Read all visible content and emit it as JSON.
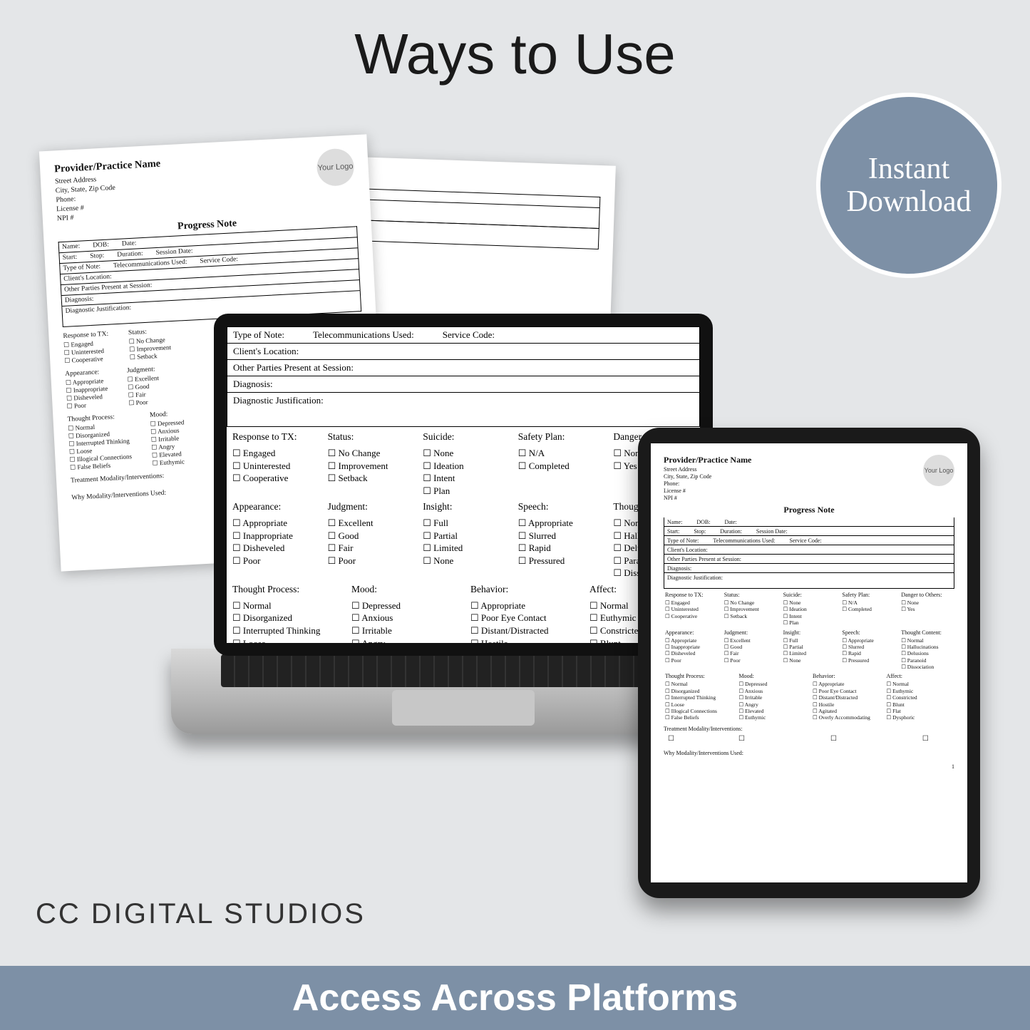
{
  "heading": "Ways to Use",
  "badge": {
    "line1": "Instant",
    "line2": "Download"
  },
  "brand": "CC DIGITAL STUDIOS",
  "footer": "Access Across Platforms",
  "provider": {
    "name": "Provider/Practice Name",
    "addr": [
      "Street Address",
      "City, State, Zip Code",
      "Phone:",
      "License #",
      "NPI #"
    ],
    "logo": "Your Logo"
  },
  "form": {
    "title": "Progress Note",
    "rows": {
      "name": "Name:",
      "dob": "DOB:",
      "date": "Date:",
      "start": "Start:",
      "stop": "Stop:",
      "duration": "Duration:",
      "session_date": "Session Date:",
      "type_of_note": "Type of Note:",
      "telecom": "Telecommunications Used:",
      "service_code": "Service Code:",
      "client_location": "Client's Location:",
      "other_parties": "Other Parties Present at Session:",
      "diagnosis": "Diagnosis:",
      "diag_just": "Diagnostic Justification:",
      "treatment_modality": "Treatment Modality/Interventions:",
      "why_modality": "Why Modality/Interventions Used:"
    },
    "sections": {
      "response_to_tx": {
        "title": "Response to TX:",
        "items": [
          "Engaged",
          "Uninterested",
          "Cooperative"
        ]
      },
      "status": {
        "title": "Status:",
        "items": [
          "No Change",
          "Improvement",
          "Setback"
        ]
      },
      "suicide": {
        "title": "Suicide:",
        "items": [
          "None",
          "Ideation",
          "Intent",
          "Plan"
        ]
      },
      "safety_plan": {
        "title": "Safety Plan:",
        "items": [
          "N/A",
          "Completed"
        ]
      },
      "danger": {
        "title": "Danger to Others:",
        "items": [
          "None",
          "Yes"
        ]
      },
      "appearance": {
        "title": "Appearance:",
        "items": [
          "Appropriate",
          "Inappropriate",
          "Disheveled",
          "Poor"
        ]
      },
      "judgment": {
        "title": "Judgment:",
        "items": [
          "Excellent",
          "Good",
          "Fair",
          "Poor"
        ]
      },
      "insight": {
        "title": "Insight:",
        "items": [
          "Full",
          "Partial",
          "Limited",
          "None"
        ]
      },
      "speech": {
        "title": "Speech:",
        "items": [
          "Appropriate",
          "Slurred",
          "Rapid",
          "Pressured"
        ]
      },
      "thought_content": {
        "title": "Thought Content:",
        "items": [
          "Normal",
          "Hallucinations",
          "Delusions",
          "Paranoid",
          "Dissociation"
        ]
      },
      "thought_process": {
        "title": "Thought Process:",
        "items": [
          "Normal",
          "Disorganized",
          "Interrupted Thinking",
          "Loose",
          "Illogical Connections",
          "False Beliefs"
        ]
      },
      "mood": {
        "title": "Mood:",
        "items": [
          "Depressed",
          "Anxious",
          "Irritable",
          "Angry",
          "Elevated",
          "Euthymic"
        ]
      },
      "behavior": {
        "title": "Behavior:",
        "items": [
          "Appropriate",
          "Poor Eye Contact",
          "Distant/Distracted",
          "Hostile",
          "Agitated",
          "Overly Accommodating"
        ]
      },
      "affect": {
        "title": "Affect:",
        "items": [
          "Normal",
          "Euthymic",
          "Constricted",
          "Blunt",
          "Flat",
          "Dysphoric"
        ]
      }
    },
    "page_number": "1"
  },
  "laptop_thought_content_cut": [
    "Normal",
    "Hallucin",
    "Delusion",
    "Paranoid",
    "Dissociat"
  ],
  "laptop_danger_title_cut": "Danger to Ot"
}
